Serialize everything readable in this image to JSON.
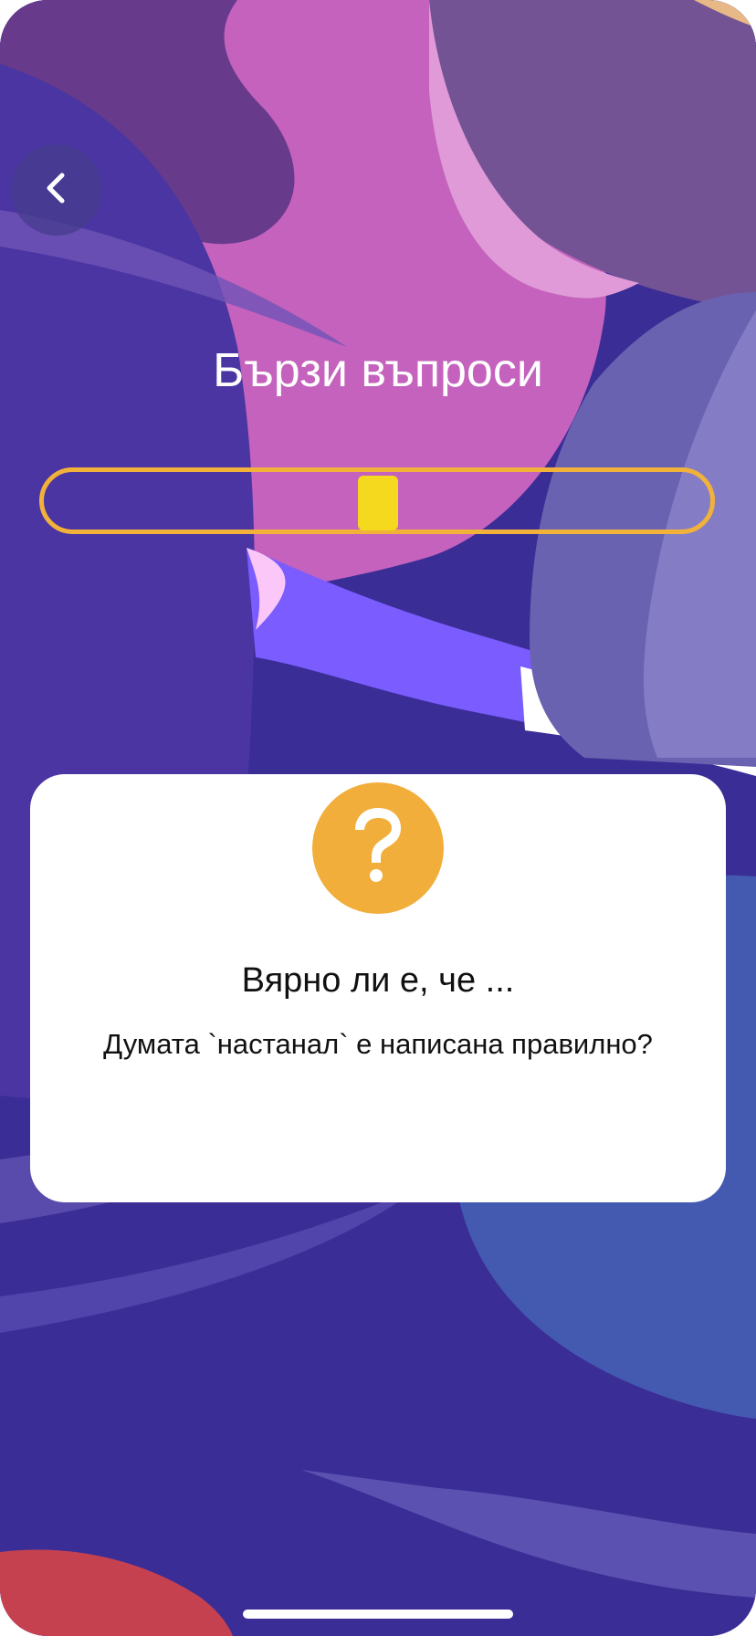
{
  "header": {
    "back_icon": "chevron-left-icon",
    "title": "Бързи въпроси"
  },
  "progress": {
    "track_color": "#f2b23a",
    "indicator_color": "#f4d91e",
    "current_fraction": 0.5
  },
  "question_card": {
    "icon": "question-mark-icon",
    "icon_color": "#f2ae3b",
    "heading": "Вярно ли е, че ...",
    "text": "Думата `настанал` е написана правилно?"
  },
  "colors": {
    "background": "#3b2d96",
    "accent": "#f2ae3b",
    "card": "#ffffff"
  }
}
